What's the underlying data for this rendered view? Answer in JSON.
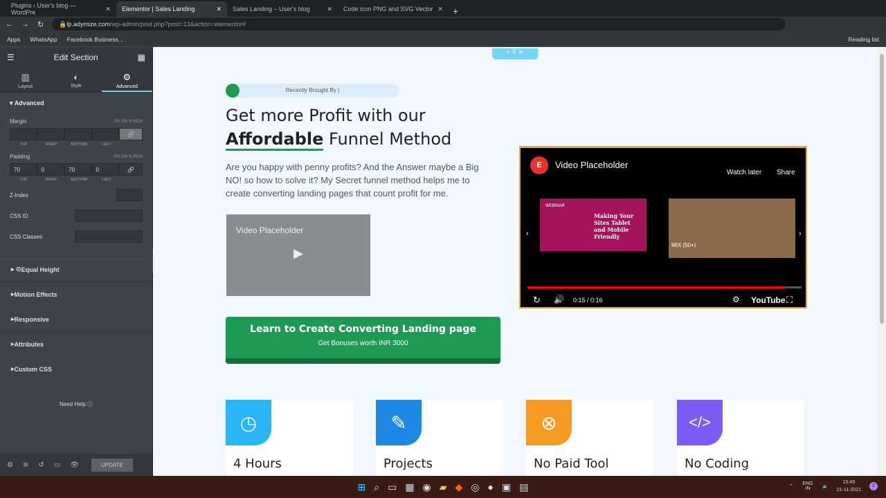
{
  "browser": {
    "tabs": [
      {
        "label": "Plugins ‹ User's blog — WordPre"
      },
      {
        "label": "Elementor | Sales Landing",
        "active": true
      },
      {
        "label": "Sales Landing – User's blog"
      },
      {
        "label": "Code icon PNG and SVG Vector"
      }
    ],
    "url_host": "lp.adymize.com",
    "url_path": "/wp-admin/post.php?post=13&action=elementor#",
    "bookmarks": [
      "Apps",
      "WhatsApp",
      "Facebook Business..."
    ],
    "reading_list": "Reading list"
  },
  "panel": {
    "title": "Edit Section",
    "tabs": [
      "Layout",
      "Style",
      "Advanced"
    ],
    "section": "Advanced",
    "margin_label": "Margin",
    "padding_label": "Padding",
    "units": "PX  EM  %  REM",
    "dim_labels": [
      "TOP",
      "RIGHT",
      "BOTTOM",
      "LEFT"
    ],
    "padding": [
      "70",
      "0",
      "70",
      "0"
    ],
    "zindex": "Z-Index",
    "cssid": "CSS ID",
    "cssclasses": "CSS Classes",
    "accordions": [
      "Equal Height",
      "Motion Effects",
      "Responsive",
      "Attributes",
      "Custom CSS"
    ],
    "help": "Need Help",
    "update": "UPDATE"
  },
  "page": {
    "badge": "Recently Brought By |",
    "h1_line1": "Get more Profit with our",
    "h1_bold": "Affordable",
    "h1_rest": " Funnel Method",
    "desc": "Are you happy with penny profits? And the Answer maybe a Big NO! so how to solve it? My Secret funnel method helps me to create converting landing pages that count profit for me.",
    "small_video_title": "Video Placeholder",
    "cta_title": "Learn to Create Converting Landing page",
    "cta_sub": "Get Bonuses worth INR 3000",
    "video": {
      "title": "Video Placeholder",
      "watch_later": "Watch later",
      "share": "Share",
      "thumb1_label": "WEBINAR",
      "thumb1_text": "Making Your Sites Tablet and Mobile Friendly",
      "mix": "MIX (50+)",
      "time": "0:15 / 0:16",
      "brand": "YouTube",
      "progress": 0.94
    },
    "cards": [
      {
        "title": "4 Hours",
        "color": "#29b6f6",
        "icon": "clock-icon"
      },
      {
        "title": "Projects",
        "color": "#1e88e5",
        "icon": "pencil-icon"
      },
      {
        "title": "No Paid Tool",
        "color": "#f59a23",
        "icon": "x-circle-icon"
      },
      {
        "title": "No Coding",
        "color": "#7c5cf5",
        "icon": "code-icon"
      }
    ]
  },
  "taskbar": {
    "lang": "ENG IN",
    "time": "15:49",
    "date": "21-11-2021",
    "notif": "2"
  }
}
